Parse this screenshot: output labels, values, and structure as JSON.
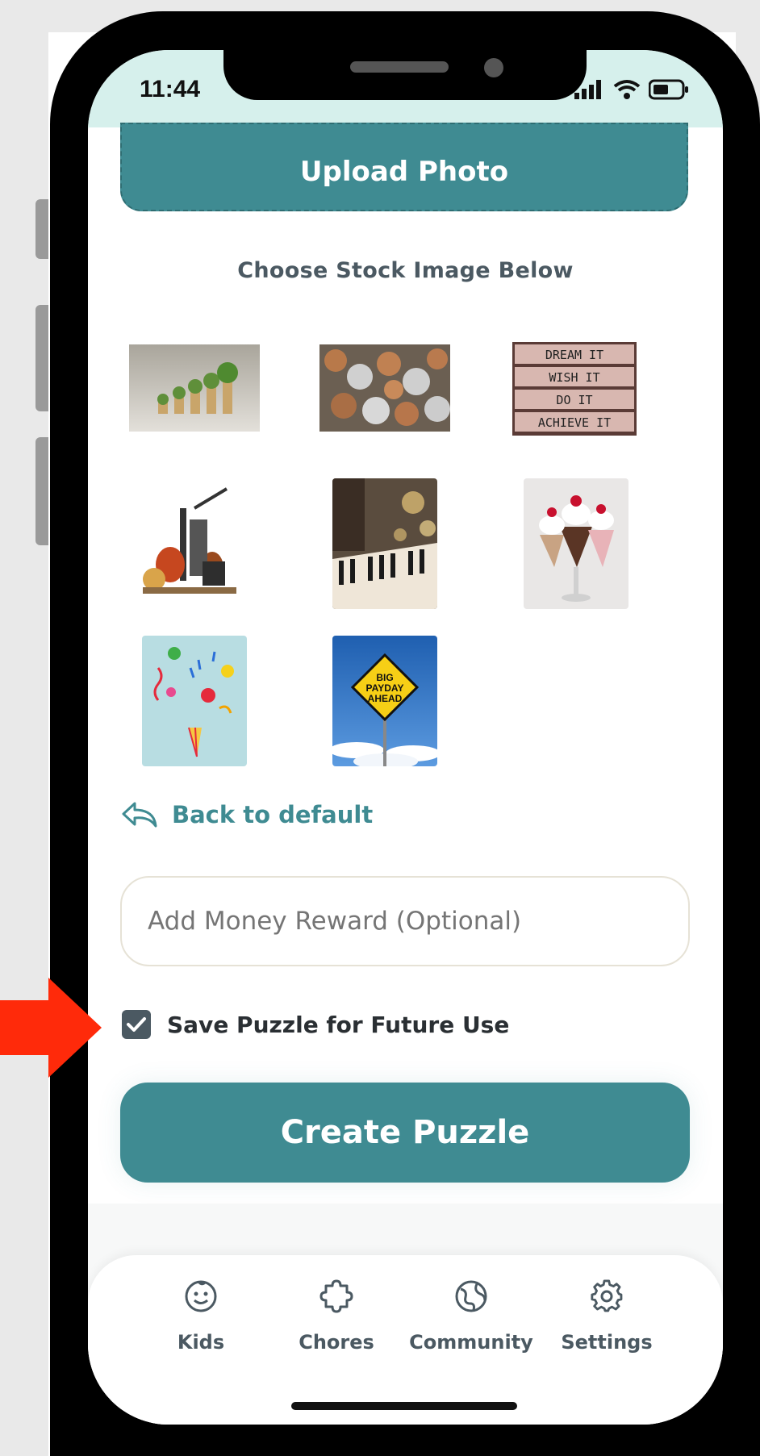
{
  "status_bar": {
    "time": "11:44"
  },
  "upload_button_label": "Upload Photo",
  "stock_heading": "Choose Stock Image Below",
  "stock_images": [
    {
      "name": "coins-plants-image"
    },
    {
      "name": "coin-pile-image"
    },
    {
      "name": "dream-sign-image",
      "lines": [
        "DREAM IT",
        "WISH IT",
        "DO IT",
        "ACHIEVE IT"
      ]
    },
    {
      "name": "musical-instruments-image"
    },
    {
      "name": "piano-keys-image"
    },
    {
      "name": "ice-cream-sundae-image"
    },
    {
      "name": "party-popper-image"
    },
    {
      "name": "payday-sign-image",
      "lines": [
        "BIG",
        "PAYDAY",
        "AHEAD"
      ]
    }
  ],
  "back_link_label": "Back to default",
  "reward_input": {
    "placeholder": "Add Money Reward (Optional)",
    "value": ""
  },
  "save_checkbox": {
    "label": "Save Puzzle for Future Use",
    "checked": true
  },
  "create_button_label": "Create Puzzle",
  "tabs": [
    {
      "label": "Kids",
      "icon": "face-icon"
    },
    {
      "label": "Chores",
      "icon": "puzzle-icon"
    },
    {
      "label": "Community",
      "icon": "globe-icon"
    },
    {
      "label": "Settings",
      "icon": "gear-icon"
    }
  ],
  "colors": {
    "accent": "#3f8b92",
    "status_bg": "#d6f0ec",
    "arrow": "#ff2a0a"
  }
}
